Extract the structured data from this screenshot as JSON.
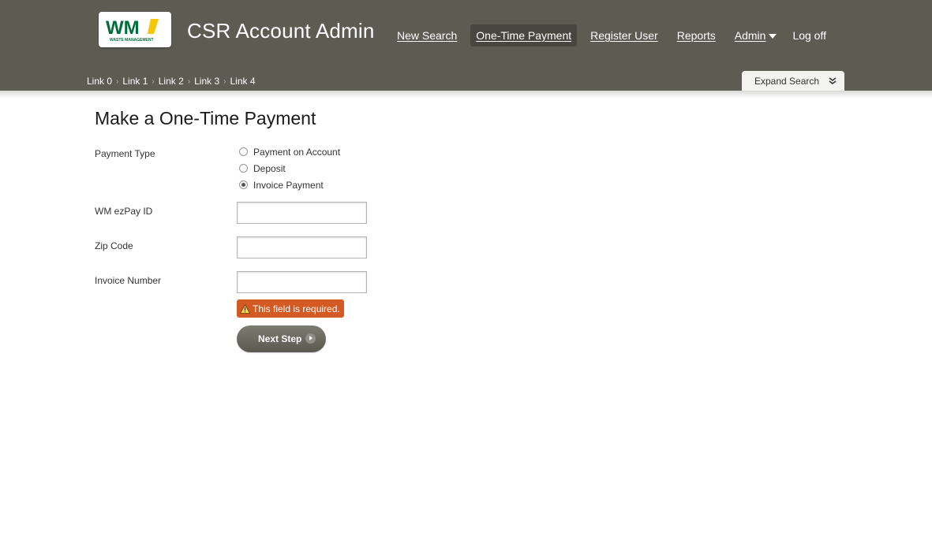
{
  "header": {
    "logo": {
      "text": "WM",
      "subtext": "WASTE MANAGEMENT",
      "icon": "wm-logo"
    },
    "app_title": "CSR Account Admin",
    "nav": [
      {
        "label": "New Search"
      },
      {
        "label": "One-Time Payment",
        "active": true
      },
      {
        "label": "Register User"
      },
      {
        "label": "Reports"
      },
      {
        "label": "Admin",
        "dropdown": true
      },
      {
        "label": "Log off"
      }
    ],
    "breadcrumb": [
      "Link 0",
      "Link 1",
      "Link 2",
      "Link 3",
      "Link 4"
    ],
    "expand_search": {
      "label": "Expand Search",
      "icon": "double-chevron-down-icon"
    }
  },
  "form": {
    "title": "Make a One-Time Payment",
    "payment_type": {
      "label": "Payment Type",
      "options": [
        "Payment on Account",
        "Deposit",
        "Invoice Payment"
      ],
      "selected": "Invoice Payment"
    },
    "ezpay_id": {
      "label": "WM ezPay ID",
      "value": ""
    },
    "zip_code": {
      "label": "Zip Code",
      "value": ""
    },
    "invoice_number": {
      "label": "Invoice Number",
      "value": ""
    },
    "error": {
      "text": "This field is required.",
      "icon": "warning-icon"
    },
    "next_button": {
      "label": "Next Step",
      "icon": "arrow-right-circle-icon"
    }
  },
  "colors": {
    "header_bg": "#5c5c53",
    "active_nav_bg": "#47473f",
    "error_bg": "#d35a23",
    "button_bg": "#6a6a61",
    "logo_green": "#006e3c",
    "logo_yellow": "#f7c600"
  }
}
